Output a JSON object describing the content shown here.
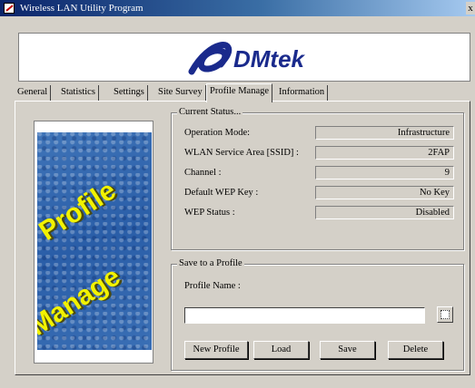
{
  "window": {
    "title": "Wireless LAN Utility Program",
    "close_glyph": "x"
  },
  "banner": {
    "logo_text": "DMtek"
  },
  "tabs": [
    {
      "label": "General"
    },
    {
      "label": "Statistics"
    },
    {
      "label": "Settings"
    },
    {
      "label": "Site Survey"
    },
    {
      "label": "Profile Manage",
      "active": true
    },
    {
      "label": "Information"
    }
  ],
  "side_image": {
    "line1": "Profile",
    "line2": "Manage"
  },
  "current_status": {
    "title": "Current Status...",
    "rows": [
      {
        "label": "Operation Mode:",
        "value": "Infrastructure"
      },
      {
        "label": "WLAN Service Area [SSID] :",
        "value": "2FAP"
      },
      {
        "label": "Channel :",
        "value": "9"
      },
      {
        "label": "Default WEP Key :",
        "value": "No Key"
      },
      {
        "label": "WEP Status :",
        "value": "Disabled"
      }
    ]
  },
  "save_profile": {
    "title": "Save to a Profile",
    "name_label": "Profile Name :",
    "name_value": "",
    "buttons": {
      "new": "New Profile",
      "load": "Load",
      "save": "Save",
      "delete": "Delete"
    }
  },
  "colors": {
    "face": "#d4d0c8",
    "title_start": "#0a246a",
    "title_end": "#a6caf0",
    "logo_blue": "#1a2a8c"
  }
}
